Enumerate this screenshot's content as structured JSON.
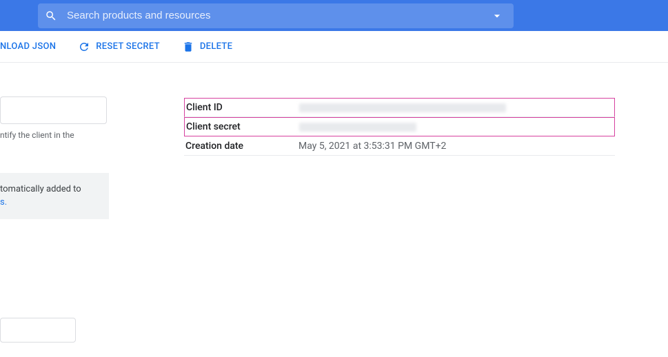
{
  "search": {
    "placeholder": "Search products and resources"
  },
  "actions": {
    "download_json": "NLOAD JSON",
    "reset_secret": "RESET SECRET",
    "delete": "DELETE"
  },
  "left": {
    "helper_text": "ntify the client in the",
    "info_line1": "tomatically added to",
    "info_link": "s."
  },
  "detail": {
    "rows": [
      {
        "label": "Client ID",
        "value": ""
      },
      {
        "label": "Client secret",
        "value": ""
      },
      {
        "label": "Creation date",
        "value": "May 5, 2021 at 3:53:31 PM GMT+2"
      }
    ]
  }
}
